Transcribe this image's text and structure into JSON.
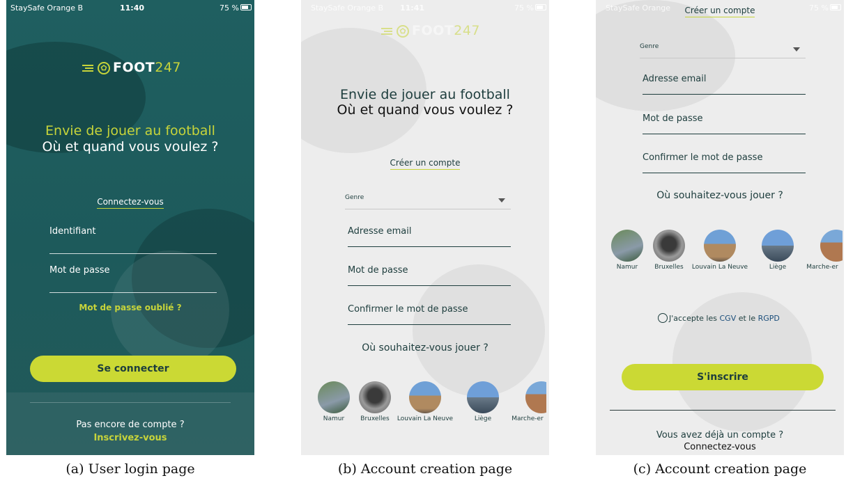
{
  "login": {
    "status": {
      "carrier": "StaySafe Orange B",
      "time": "11:40",
      "battery": "75 %"
    },
    "logo": {
      "word": "FOOT",
      "number": "247"
    },
    "tagline1": "Envie de jouer au football",
    "tagline2": "Où et quand vous voulez ?",
    "connect_link": "Connectez-vous",
    "id_placeholder": "Identifiant",
    "password_placeholder": "Mot de passe",
    "forgot_link": "Mot de passe oublié ?",
    "login_button": "Se connecter",
    "no_account": "Pas encore de compte ?",
    "signup_link": "Inscrivez-vous",
    "caption": "(a) User login page"
  },
  "create": {
    "status": {
      "carrier": "StaySafe Orange B",
      "time": "11:41",
      "battery": "75 %"
    },
    "logo": {
      "word": "FOOT",
      "number": "247"
    },
    "tagline1": "Envie de jouer au football",
    "tagline2": "Où et quand vous voulez ?",
    "create_link": "Créer un compte",
    "genre_label": "Genre",
    "email_placeholder": "Adresse email",
    "password_placeholder": "Mot de passe",
    "confirm_placeholder": "Confirmer le mot de passe",
    "where_label": "Où souhaitez-vous jouer ?",
    "cities": [
      "Namur",
      "Bruxelles",
      "Louvain La Neuve",
      "Liège",
      "Marche-er"
    ],
    "caption": "(b) Account creation page"
  },
  "create2": {
    "status": {
      "carrier": "StaySafe Orange",
      "battery": "75 %"
    },
    "create_link": "Créer un compte",
    "genre_label": "Genre",
    "email_placeholder": "Adresse email",
    "password_placeholder": "Mot de passe",
    "confirm_placeholder": "Confirmer le mot de passe",
    "where_label": "Où souhaitez-vous jouer ?",
    "cities": [
      "Namur",
      "Bruxelles",
      "Louvain La Neuve",
      "Liège",
      "Marche-er"
    ],
    "terms_prefix": "J'accepte les ",
    "terms_cgv": "CGV",
    "terms_mid": " et le ",
    "terms_rgpd": "RGPD",
    "signup_button": "S'inscrire",
    "have_account": "Vous avez déjà un compte ?",
    "connect_link": "Connectez-vous",
    "caption": "(c) Account creation page"
  },
  "colors": {
    "teal": "#1f5f60",
    "accent": "#c7d43a",
    "button": "#cbd934",
    "dark": "#1d3d3d"
  }
}
